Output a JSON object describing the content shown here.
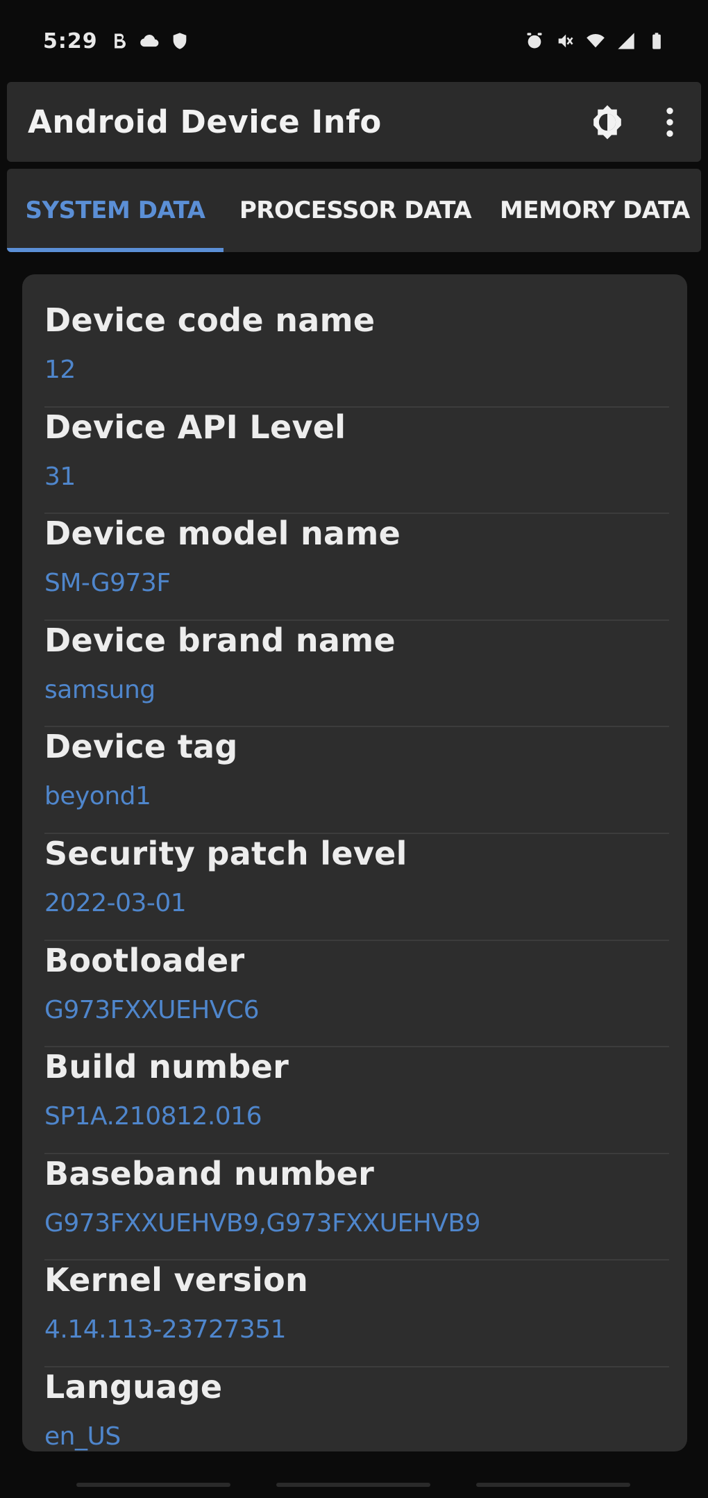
{
  "status_bar": {
    "time": "5:29",
    "left_icons": [
      "notification-b-icon",
      "cloud-icon",
      "shield-icon"
    ],
    "right_icons": [
      "alarm-icon",
      "mute-icon",
      "wifi-icon",
      "signal-icon",
      "battery-icon"
    ]
  },
  "app_bar": {
    "title": "Android Device Info",
    "actions": [
      "theme-toggle-icon",
      "more-vert-icon"
    ]
  },
  "tabs": [
    {
      "label": "SYSTEM DATA",
      "active": true
    },
    {
      "label": "PROCESSOR DATA",
      "active": false
    },
    {
      "label": "MEMORY DATA",
      "active": false
    }
  ],
  "rows": [
    {
      "label": "Device code name",
      "value": "12"
    },
    {
      "label": "Device API Level",
      "value": "31"
    },
    {
      "label": "Device model name",
      "value": "SM-G973F"
    },
    {
      "label": "Device brand name",
      "value": "samsung"
    },
    {
      "label": "Device tag",
      "value": "beyond1"
    },
    {
      "label": "Security patch level",
      "value": "2022-03-01"
    },
    {
      "label": "Bootloader",
      "value": "G973FXXUEHVC6"
    },
    {
      "label": "Build number",
      "value": "SP1A.210812.016"
    },
    {
      "label": "Baseband number",
      "value": "G973FXXUEHVB9,G973FXXUEHVB9"
    },
    {
      "label": "Kernel version",
      "value": "4.14.113-23727351"
    },
    {
      "label": "Language",
      "value": "en_US"
    }
  ],
  "colors": {
    "accent": "#5b8fd6",
    "value_text": "#4f86cc",
    "surface": "#2d2d2d",
    "background": "#0b0b0b"
  }
}
